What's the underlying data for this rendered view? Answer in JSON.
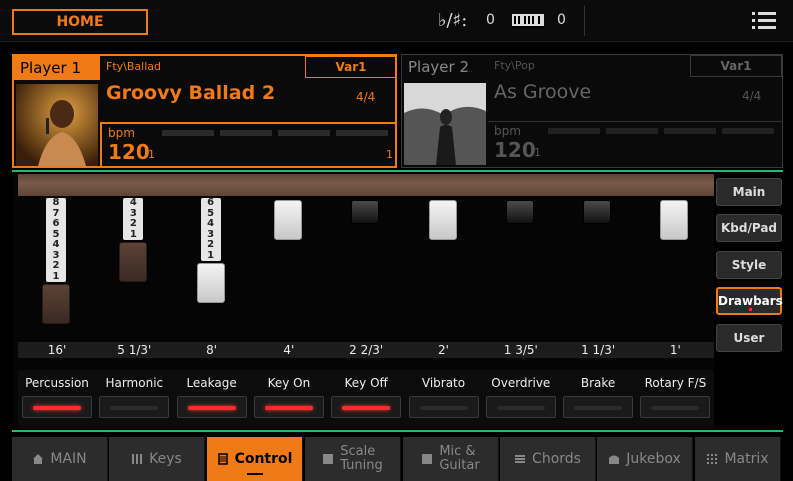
{
  "topbar": {
    "home_label": "HOME",
    "transpose_symbol": "♭/♯:",
    "transpose_value": "0",
    "octave_value": "0",
    "menu_icon": "menu-list-icon"
  },
  "player1": {
    "label": "Player 1",
    "category": "Fty\\Ballad",
    "variation": "Var1",
    "name": "Groovy Ballad 2",
    "time_sig": "4/4",
    "bpm_label": "bpm",
    "bpm": "120",
    "beat": "1",
    "measure": "1"
  },
  "player2": {
    "label": "Player 2",
    "category": "Fty\\Pop",
    "variation": "Var1",
    "name": "As Groove",
    "time_sig": "4/4",
    "bpm_label": "bpm",
    "bpm": "120",
    "beat": "1",
    "measure": ""
  },
  "drawbars": [
    {
      "footage": "16'",
      "level": 8,
      "numbers": [
        "8",
        "7",
        "6",
        "5",
        "4",
        "3",
        "2",
        "1"
      ],
      "color": "brown"
    },
    {
      "footage": "5 1/3'",
      "level": 4,
      "numbers": [
        "4",
        "3",
        "2",
        "1"
      ],
      "color": "brown"
    },
    {
      "footage": "8'",
      "level": 6,
      "numbers": [
        "6",
        "5",
        "4",
        "3",
        "2",
        "1"
      ],
      "color": "white"
    },
    {
      "footage": "4'",
      "level": 0,
      "numbers": [],
      "color": "white"
    },
    {
      "footage": "2 2/3'",
      "level": 0,
      "numbers": [],
      "color": "black"
    },
    {
      "footage": "2'",
      "level": 0,
      "numbers": [],
      "color": "white"
    },
    {
      "footage": "1 3/5'",
      "level": 0,
      "numbers": [],
      "color": "black"
    },
    {
      "footage": "1 1/3'",
      "level": 0,
      "numbers": [],
      "color": "black"
    },
    {
      "footage": "1'",
      "level": 0,
      "numbers": [],
      "color": "white"
    }
  ],
  "switches": [
    {
      "label": "Percussion",
      "on": true
    },
    {
      "label": "Harmonic",
      "on": false
    },
    {
      "label": "Leakage",
      "on": true
    },
    {
      "label": "Key On",
      "on": true
    },
    {
      "label": "Key Off",
      "on": true
    },
    {
      "label": "Vibrato",
      "on": false
    },
    {
      "label": "Overdrive",
      "on": false
    },
    {
      "label": "Brake",
      "on": false
    },
    {
      "label": "Rotary F/S",
      "on": false
    }
  ],
  "right_tabs": [
    "Main",
    "Kbd/Pad",
    "Style",
    "Drawbars",
    "User"
  ],
  "right_tab_active": "Drawbars",
  "bottom_nav": [
    {
      "label": "MAIN",
      "icon": "home-icon"
    },
    {
      "label": "Keys",
      "icon": "keys-icon"
    },
    {
      "label": "Control",
      "icon": "control-icon"
    },
    {
      "label": "Scale",
      "label2": "Tuning",
      "icon": "scale-icon"
    },
    {
      "label": "Mic &",
      "label2": "Guitar",
      "icon": "mic-icon"
    },
    {
      "label": "Chords",
      "icon": "chords-icon"
    },
    {
      "label": "Jukebox",
      "icon": "jukebox-icon"
    },
    {
      "label": "Matrix",
      "icon": "matrix-icon"
    }
  ],
  "bottom_nav_active": "Control",
  "colors": {
    "accent": "#f07a16",
    "green": "#2bb673",
    "led_on": "#ff2a2a"
  }
}
